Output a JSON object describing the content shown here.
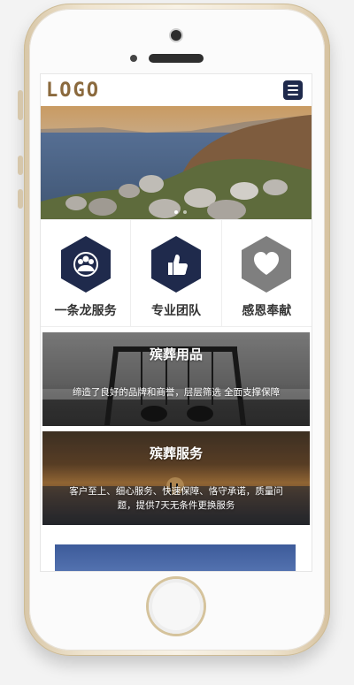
{
  "header": {
    "logo": "LOGO"
  },
  "features": [
    {
      "label": "一条龙服务",
      "icon": "group-icon"
    },
    {
      "label": "专业团队",
      "icon": "thumbs-up-icon"
    },
    {
      "label": "感恩奉献",
      "icon": "heart-icon"
    }
  ],
  "cards": [
    {
      "title": "殡葬用品",
      "text": "缔造了良好的品牌和商誉，层层筛选 全面支撑保障"
    },
    {
      "title": "殡葬服务",
      "text": "客户至上、细心服务、快速保障、恪守承诺，质量问题，提供7天无条件更换服务"
    }
  ],
  "colors": {
    "logo": "#8b6a3e",
    "accent": "#1f2a4c",
    "feature_gray": "#7f7f7f"
  }
}
